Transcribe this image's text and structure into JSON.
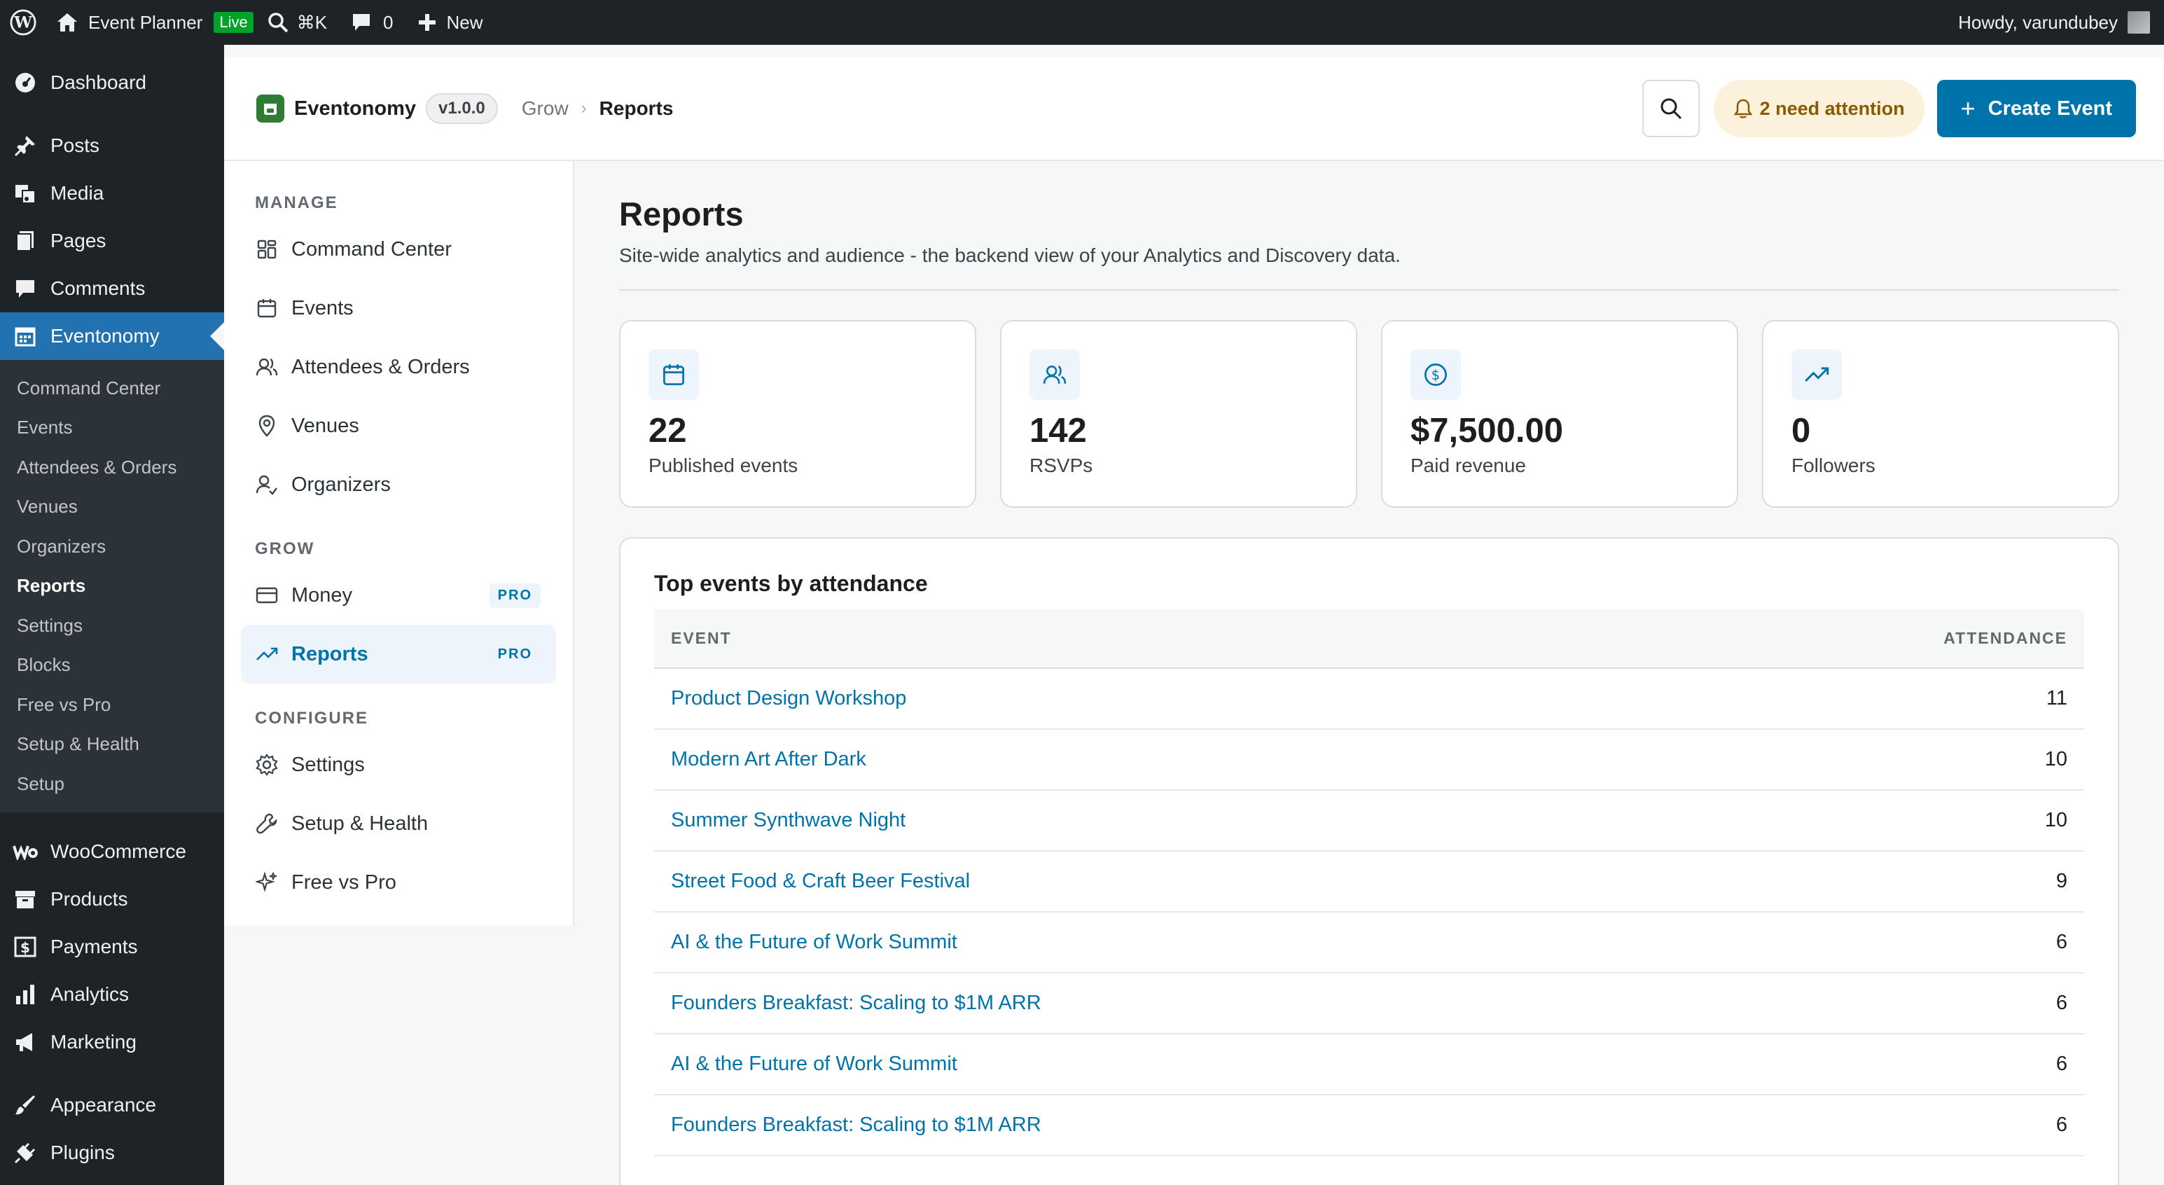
{
  "adminbar": {
    "site_name": "Event Planner",
    "live_label": "Live",
    "search_shortcut": "⌘K",
    "comments_count": "0",
    "new_label": "New",
    "howdy": "Howdy, varundubey"
  },
  "wp_menu": {
    "dashboard": "Dashboard",
    "posts": "Posts",
    "media": "Media",
    "pages": "Pages",
    "comments": "Comments",
    "eventonomy": "Eventonomy",
    "submenu": [
      "Command Center",
      "Events",
      "Attendees & Orders",
      "Venues",
      "Organizers",
      "Reports",
      "Settings",
      "Blocks",
      "Free vs Pro",
      "Setup & Health",
      "Setup"
    ],
    "woocommerce": "WooCommerce",
    "products": "Products",
    "payments": "Payments",
    "analytics": "Analytics",
    "marketing": "Marketing",
    "appearance": "Appearance",
    "plugins": "Plugins"
  },
  "header": {
    "brand": "Eventonomy",
    "version": "v1.0.0",
    "breadcrumb_parent": "Grow",
    "breadcrumb_current": "Reports",
    "attention": "2 need attention",
    "create_event": "Create Event"
  },
  "nav": {
    "manage_heading": "MANAGE",
    "command_center": "Command Center",
    "events": "Events",
    "attendees_orders": "Attendees & Orders",
    "venues": "Venues",
    "organizers": "Organizers",
    "grow_heading": "GROW",
    "money": "Money",
    "reports": "Reports",
    "pro_tag": "PRO",
    "configure_heading": "CONFIGURE",
    "settings": "Settings",
    "setup_health": "Setup & Health",
    "free_vs_pro": "Free vs Pro"
  },
  "page": {
    "title": "Reports",
    "description": "Site-wide analytics and audience - the backend view of your Analytics and Discovery data."
  },
  "stats": [
    {
      "value": "22",
      "label": "Published events"
    },
    {
      "value": "142",
      "label": "RSVPs"
    },
    {
      "value": "$7,500.00",
      "label": "Paid revenue"
    },
    {
      "value": "0",
      "label": "Followers"
    }
  ],
  "top_events": {
    "title": "Top events by attendance",
    "col_event": "EVENT",
    "col_attendance": "ATTENDANCE",
    "rows": [
      {
        "event": "Product Design Workshop",
        "attendance": "11"
      },
      {
        "event": "Modern Art After Dark",
        "attendance": "10"
      },
      {
        "event": "Summer Synthwave Night",
        "attendance": "10"
      },
      {
        "event": "Street Food & Craft Beer Festival",
        "attendance": "9"
      },
      {
        "event": "AI & the Future of Work Summit",
        "attendance": "6"
      },
      {
        "event": "Founders Breakfast: Scaling to $1M ARR",
        "attendance": "6"
      },
      {
        "event": "AI & the Future of Work Summit",
        "attendance": "6"
      },
      {
        "event": "Founders Breakfast: Scaling to $1M ARR",
        "attendance": "6"
      }
    ]
  },
  "colors": {
    "accent": "#0073aa",
    "wp_admin_dark": "#1d2327",
    "wp_active": "#2271b1",
    "attention_bg": "#fcf1dd",
    "attention_text": "#8a5b00",
    "brand_green": "#2f7d32"
  }
}
